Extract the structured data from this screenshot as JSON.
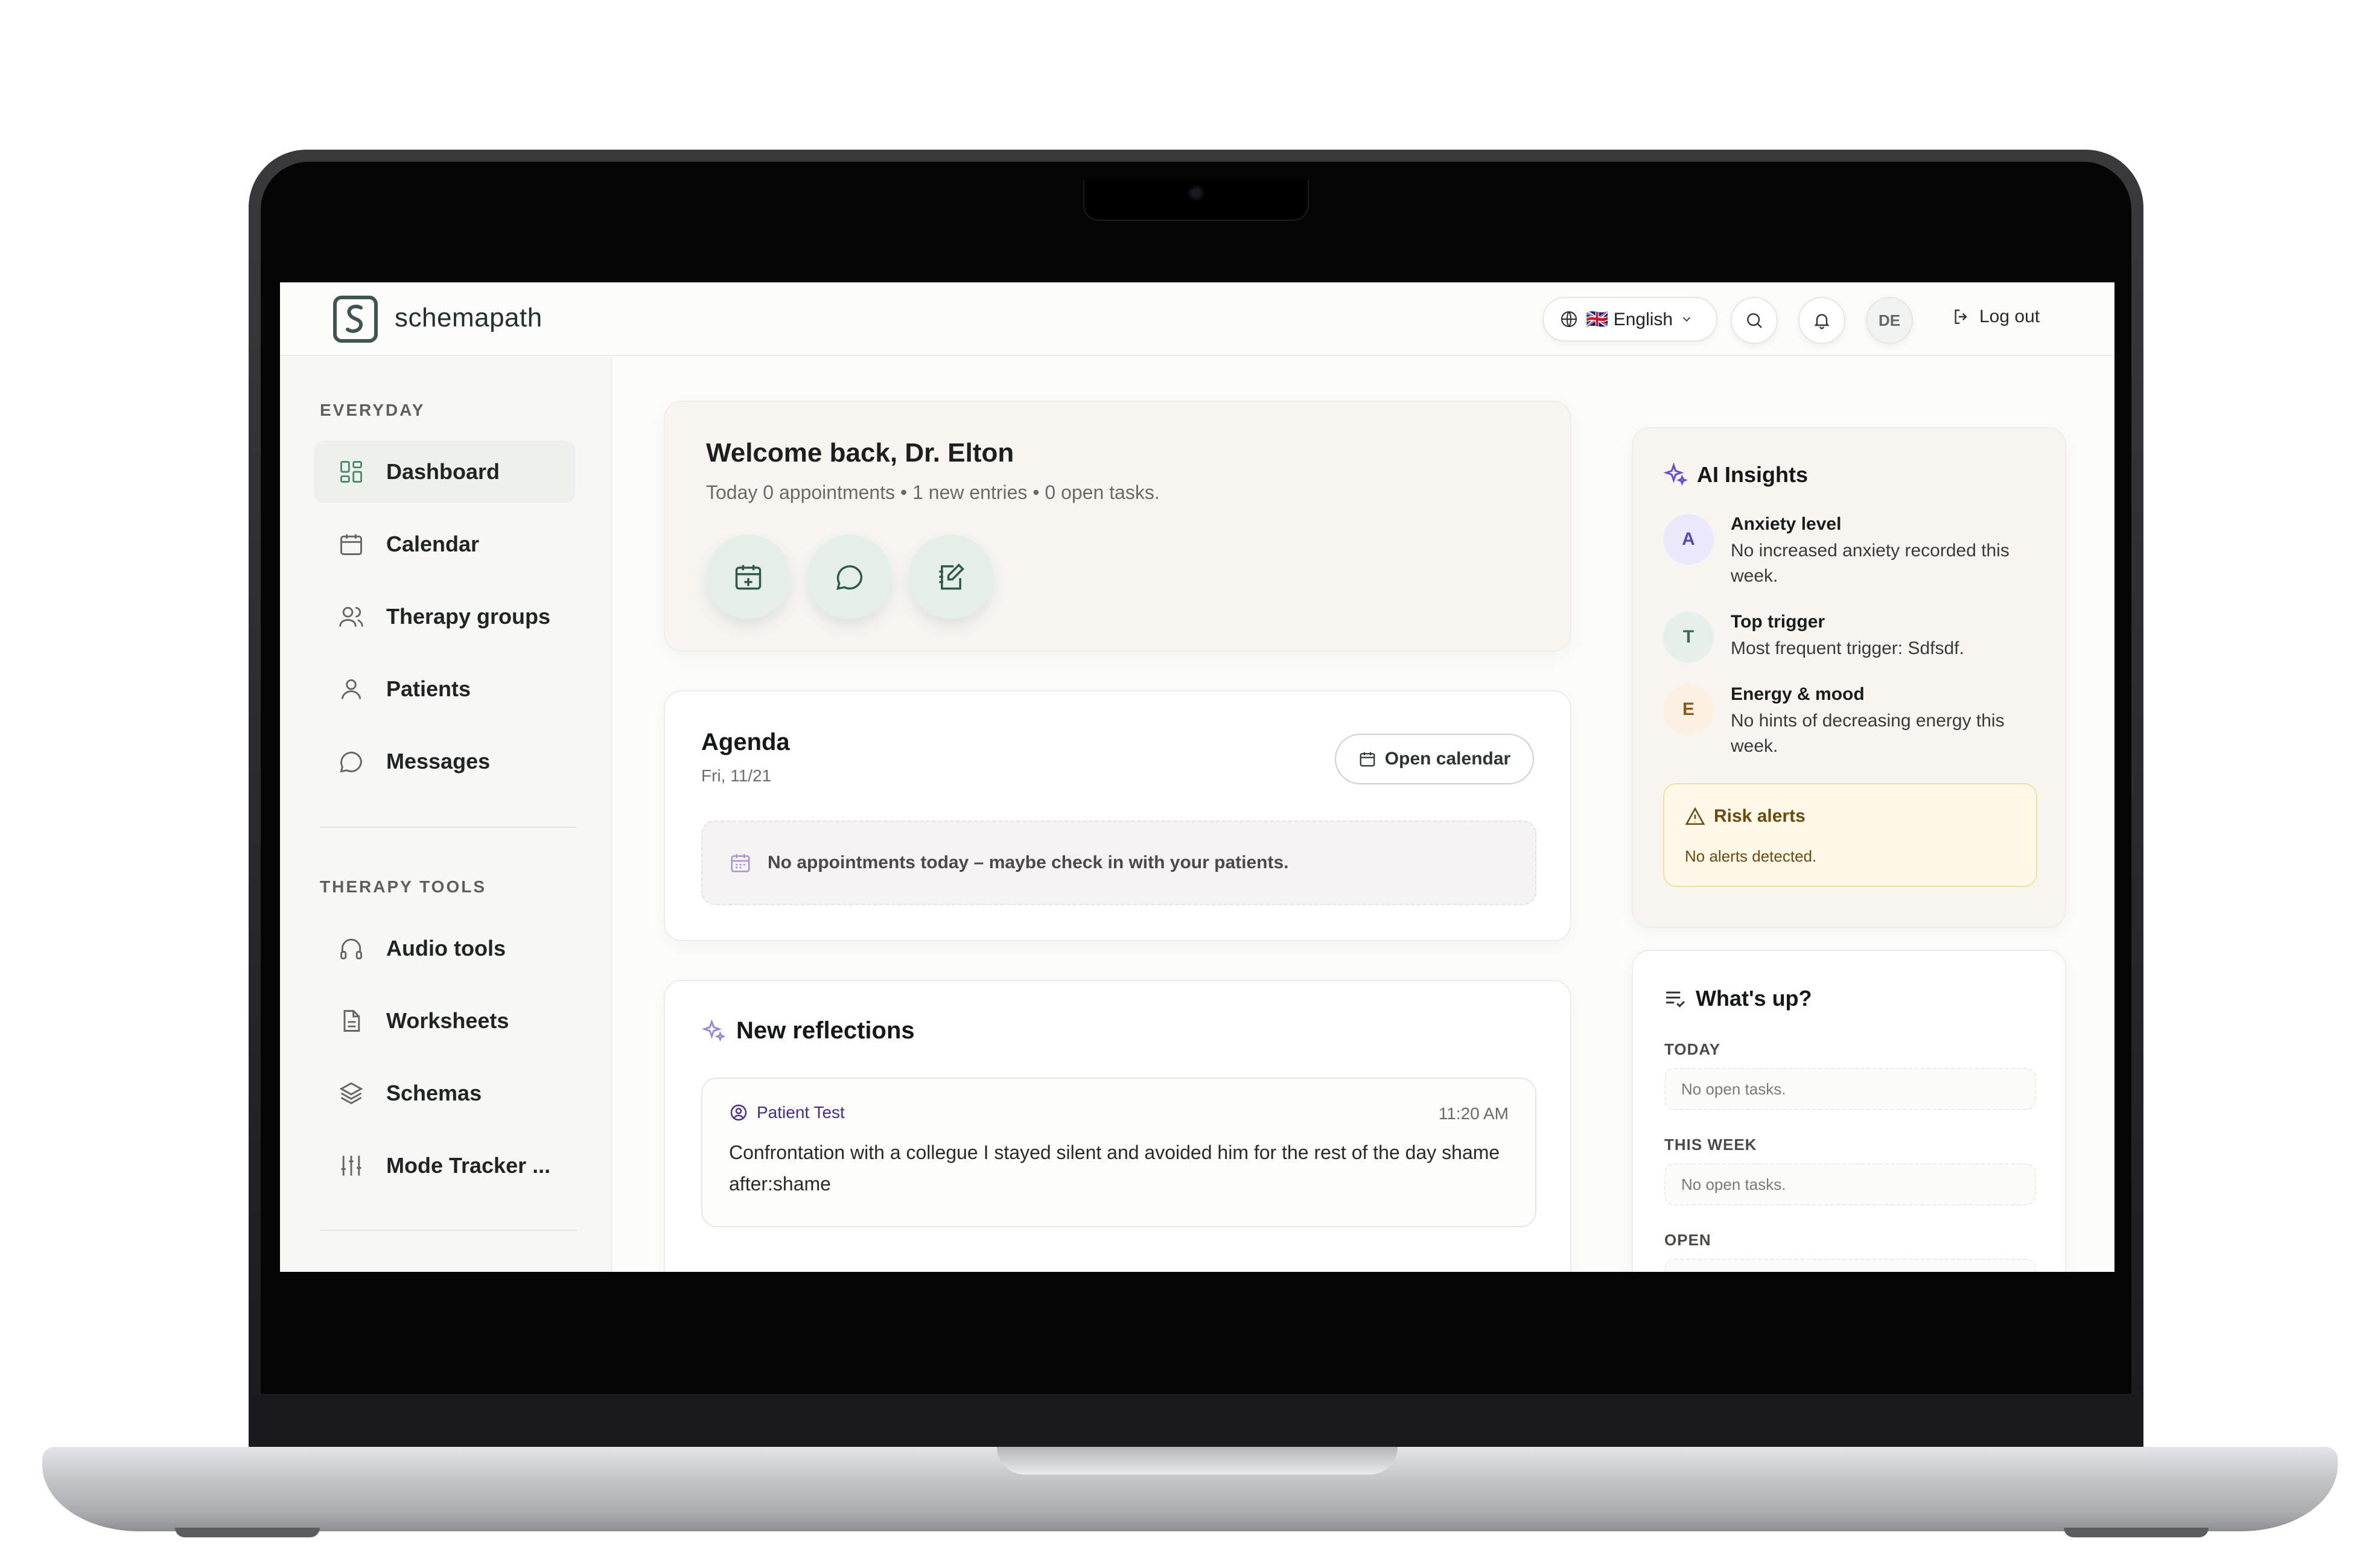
{
  "header": {
    "brand": "schemapath",
    "language": "🇬🇧 English",
    "avatar_initials": "DE",
    "logout_label": "Log out"
  },
  "sidebar": {
    "sections": [
      {
        "title": "EVERYDAY",
        "items": [
          {
            "label": "Dashboard",
            "icon": "dashboard-icon",
            "active": true
          },
          {
            "label": "Calendar",
            "icon": "calendar-icon"
          },
          {
            "label": "Therapy groups",
            "icon": "users-icon"
          },
          {
            "label": "Patients",
            "icon": "user-icon"
          },
          {
            "label": "Messages",
            "icon": "message-icon"
          }
        ]
      },
      {
        "title": "THERAPY TOOLS",
        "items": [
          {
            "label": "Audio tools",
            "icon": "headphones-icon"
          },
          {
            "label": "Worksheets",
            "icon": "file-text-icon"
          },
          {
            "label": "Schemas",
            "icon": "layers-icon"
          },
          {
            "label": "Mode Tracker ...",
            "icon": "sliders-icon"
          }
        ]
      }
    ]
  },
  "welcome": {
    "title": "Welcome back, Dr. Elton",
    "subtitle": "Today 0 appointments • 1 new entries • 0 open tasks.",
    "quick_actions": [
      "calendar-plus-icon",
      "message-icon",
      "notebook-pen-icon"
    ]
  },
  "agenda": {
    "title": "Agenda",
    "date": "Fri, 11/21",
    "open_calendar_label": "Open calendar",
    "empty_text": "No appointments today – maybe check in with your patients."
  },
  "reflections": {
    "title": "New reflections",
    "items": [
      {
        "patient": "Patient Test",
        "time": "11:20 AM",
        "text": "Confrontation with a collegue I stayed silent and avoided him for the rest of the day shame after:shame"
      }
    ]
  },
  "ai_insights": {
    "title": "AI Insights",
    "items": [
      {
        "badge": "A",
        "title": "Anxiety level",
        "body": "No increased anxiety recorded this week.",
        "color": "#ece8fb"
      },
      {
        "badge": "T",
        "title": "Top trigger",
        "body": "Most frequent trigger: Sdfsdf.",
        "color": "#e6f0ea"
      },
      {
        "badge": "E",
        "title": "Energy & mood",
        "body": "No hints of decreasing energy this week.",
        "color": "#fbf0e2"
      }
    ],
    "risk": {
      "title": "Risk alerts",
      "body": "No alerts detected."
    }
  },
  "whats_up": {
    "title": "What's up?",
    "groups": [
      {
        "label": "TODAY",
        "empty": "No open tasks."
      },
      {
        "label": "THIS WEEK",
        "empty": "No open tasks."
      },
      {
        "label": "OPEN",
        "empty": ""
      }
    ]
  },
  "colors": {
    "accent_green": "#3f5552",
    "ai_purple": "#6b4fd1",
    "warning_amber": "#6b4a10"
  }
}
